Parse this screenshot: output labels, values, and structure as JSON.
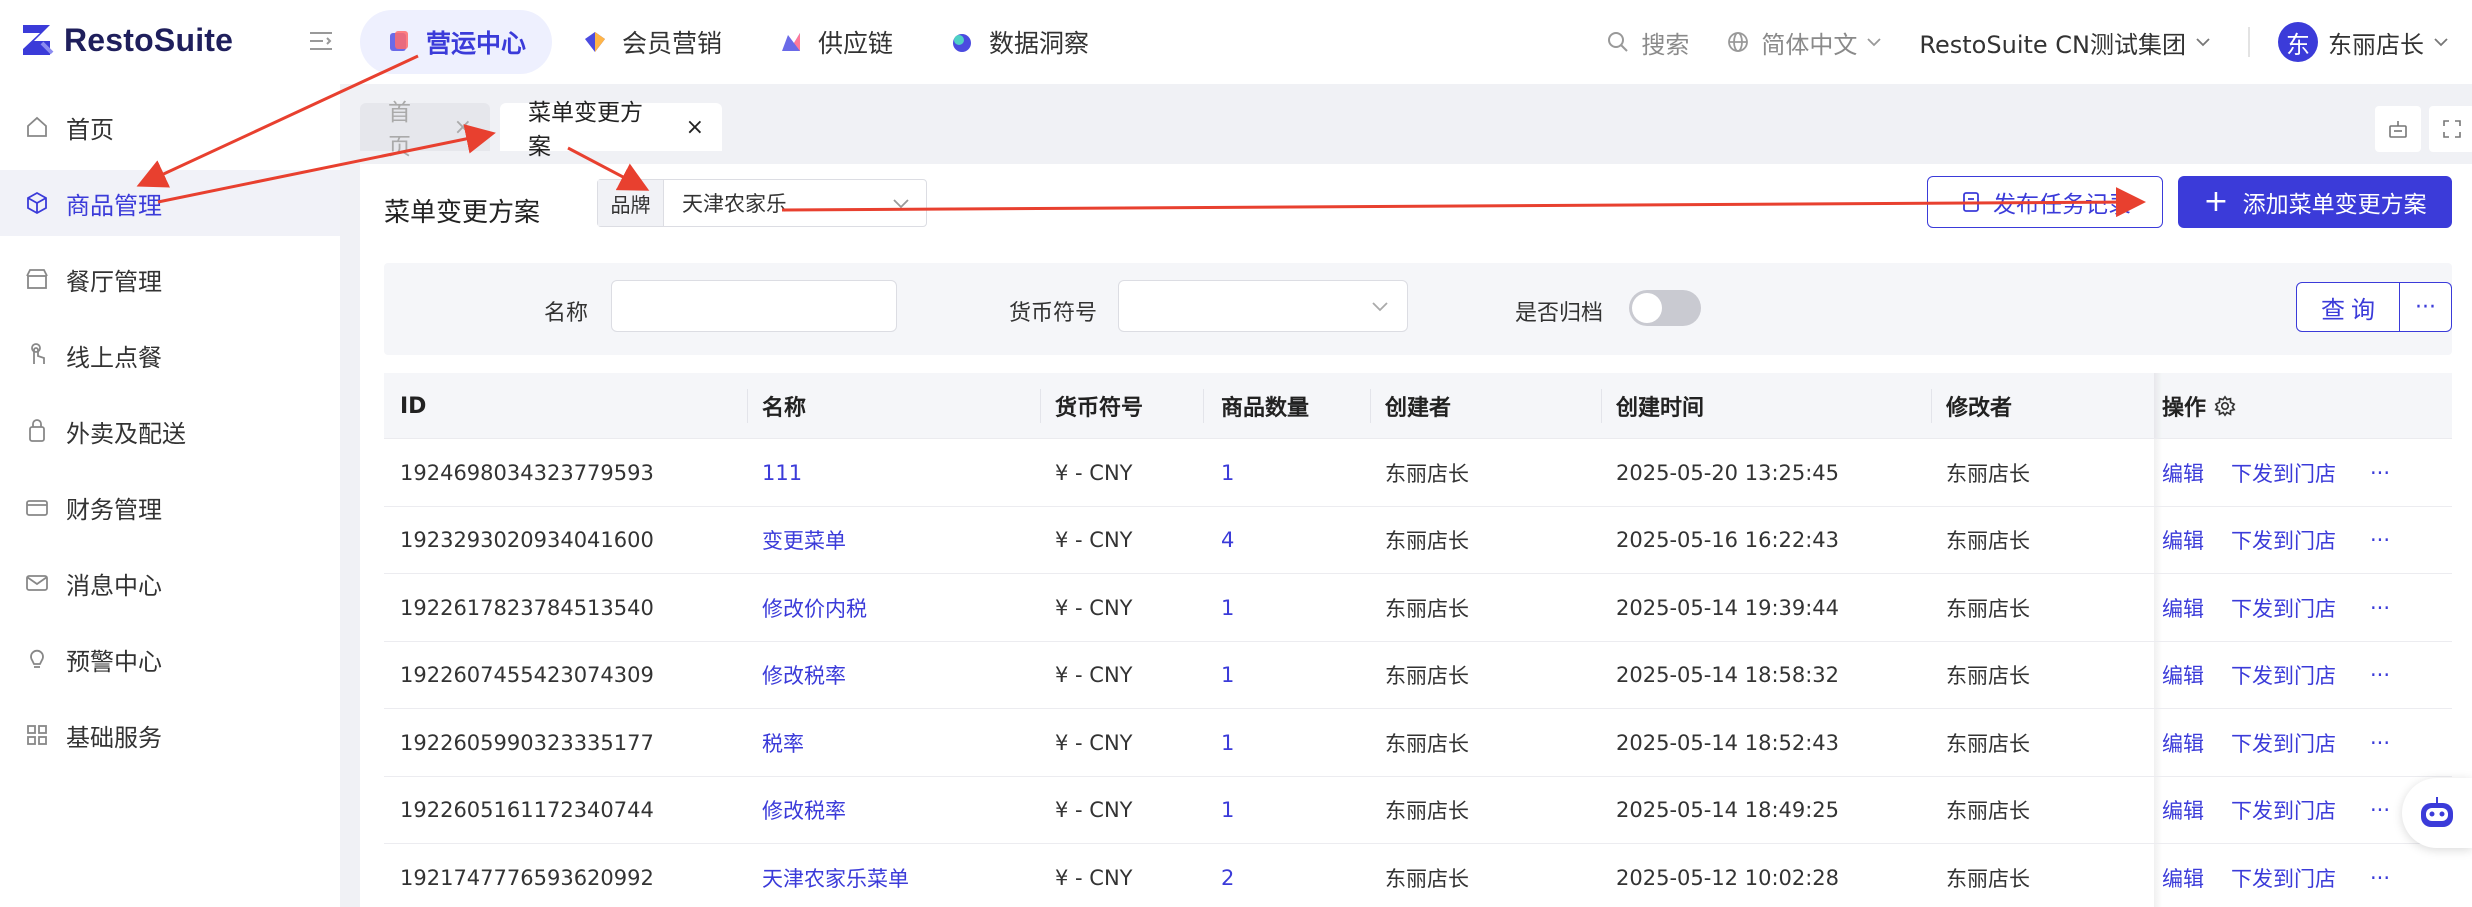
{
  "app": {
    "name": "RestoSuite"
  },
  "topnav": [
    {
      "label": "营运中心",
      "icon": "operations-icon",
      "active": true
    },
    {
      "label": "会员营销",
      "icon": "member-marketing-icon",
      "active": false
    },
    {
      "label": "供应链",
      "icon": "supply-chain-icon",
      "active": false
    },
    {
      "label": "数据洞察",
      "icon": "data-insight-icon",
      "active": false
    }
  ],
  "header": {
    "search_label": "搜索",
    "language": "简体中文",
    "org": "RestoSuite CN测试集团",
    "user_initial": "东",
    "user_name": "东丽店长"
  },
  "sidebar": [
    {
      "label": "首页",
      "icon": "home-icon",
      "active": false
    },
    {
      "label": "商品管理",
      "icon": "product-cube-icon",
      "active": true
    },
    {
      "label": "餐厅管理",
      "icon": "store-icon",
      "active": false
    },
    {
      "label": "线上点餐",
      "icon": "hand-tap-icon",
      "active": false
    },
    {
      "label": "外卖及配送",
      "icon": "delivery-bag-icon",
      "active": false
    },
    {
      "label": "财务管理",
      "icon": "wallet-icon",
      "active": false
    },
    {
      "label": "消息中心",
      "icon": "mail-icon",
      "active": false
    },
    {
      "label": "预警中心",
      "icon": "bulb-icon",
      "active": false
    },
    {
      "label": "基础服务",
      "icon": "grid-icon",
      "active": false
    }
  ],
  "tabs": {
    "home": "首页",
    "active": "菜单变更方案"
  },
  "page": {
    "title": "菜单变更方案",
    "brand_tag": "品牌",
    "brand_value": "天津农家乐",
    "publish_log_label": "发布任务记录",
    "add_label": "添加菜单变更方案"
  },
  "filters": {
    "name_label": "名称",
    "name_value": "",
    "currency_label": "货币符号",
    "currency_value": "",
    "archived_label": "是否归档",
    "archived_on": false,
    "query_label": "查询",
    "more_label": "···"
  },
  "table": {
    "columns": [
      "ID",
      "名称",
      "货币符号",
      "商品数量",
      "创建者",
      "创建时间",
      "修改者",
      "操作"
    ],
    "op_edit": "编辑",
    "op_publish": "下发到门店",
    "op_more": "···",
    "rows": [
      {
        "id": "1924698034323779593",
        "name": "111",
        "currency": "¥ - CNY",
        "count": "1",
        "creator": "东丽店长",
        "created": "2025-05-20 13:25:45",
        "modifier": "东丽店长"
      },
      {
        "id": "1923293020934041600",
        "name": "变更菜单",
        "currency": "¥ - CNY",
        "count": "4",
        "creator": "东丽店长",
        "created": "2025-05-16 16:22:43",
        "modifier": "东丽店长"
      },
      {
        "id": "1922617823784513540",
        "name": "修改价内税",
        "currency": "¥ - CNY",
        "count": "1",
        "creator": "东丽店长",
        "created": "2025-05-14 19:39:44",
        "modifier": "东丽店长"
      },
      {
        "id": "1922607455423074309",
        "name": "修改税率",
        "currency": "¥ - CNY",
        "count": "1",
        "creator": "东丽店长",
        "created": "2025-05-14 18:58:32",
        "modifier": "东丽店长"
      },
      {
        "id": "1922605990323335177",
        "name": "税率",
        "currency": "¥ - CNY",
        "count": "1",
        "creator": "东丽店长",
        "created": "2025-05-14 18:52:43",
        "modifier": "东丽店长"
      },
      {
        "id": "1922605161172340744",
        "name": "修改税率",
        "currency": "¥ - CNY",
        "count": "1",
        "creator": "东丽店长",
        "created": "2025-05-14 18:49:25",
        "modifier": "东丽店长"
      },
      {
        "id": "1921747776593620992",
        "name": "天津农家乐菜单",
        "currency": "¥ - CNY",
        "count": "2",
        "creator": "东丽店长",
        "created": "2025-05-12 10:02:28",
        "modifier": "东丽店长"
      }
    ]
  },
  "colors": {
    "accent": "#3b3bd9",
    "annotation": "#e8402f",
    "sidebar_active_bg": "#f1f2f8"
  }
}
